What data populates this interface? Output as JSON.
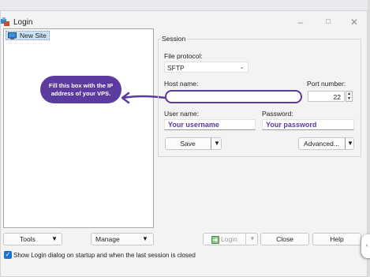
{
  "window": {
    "title": "Login"
  },
  "tree": {
    "items": [
      {
        "label": "New Site"
      }
    ]
  },
  "callout": {
    "text": "Fill this box with the IP address of your VPS."
  },
  "session": {
    "group_label": "Session",
    "file_protocol_label": "File protocol:",
    "file_protocol_value": "SFTP",
    "host_label": "Host name:",
    "host_value": "",
    "port_label": "Port number:",
    "port_value": "22",
    "user_label": "User name:",
    "user_value": "Your username",
    "password_label": "Password:",
    "password_value": "Your password",
    "save_label": "Save",
    "advanced_label": "Advanced..."
  },
  "footer": {
    "tools_label": "Tools",
    "manage_label": "Manage",
    "login_label": "Login",
    "close_label": "Close",
    "help_label": "Help",
    "checkbox_label": "Show Login dialog on startup and when the last session is closed",
    "checkbox_checked": true
  },
  "colors": {
    "accent": "#5b3b9e",
    "checkbox": "#1b73d0",
    "selection": "#cfe3f7"
  }
}
